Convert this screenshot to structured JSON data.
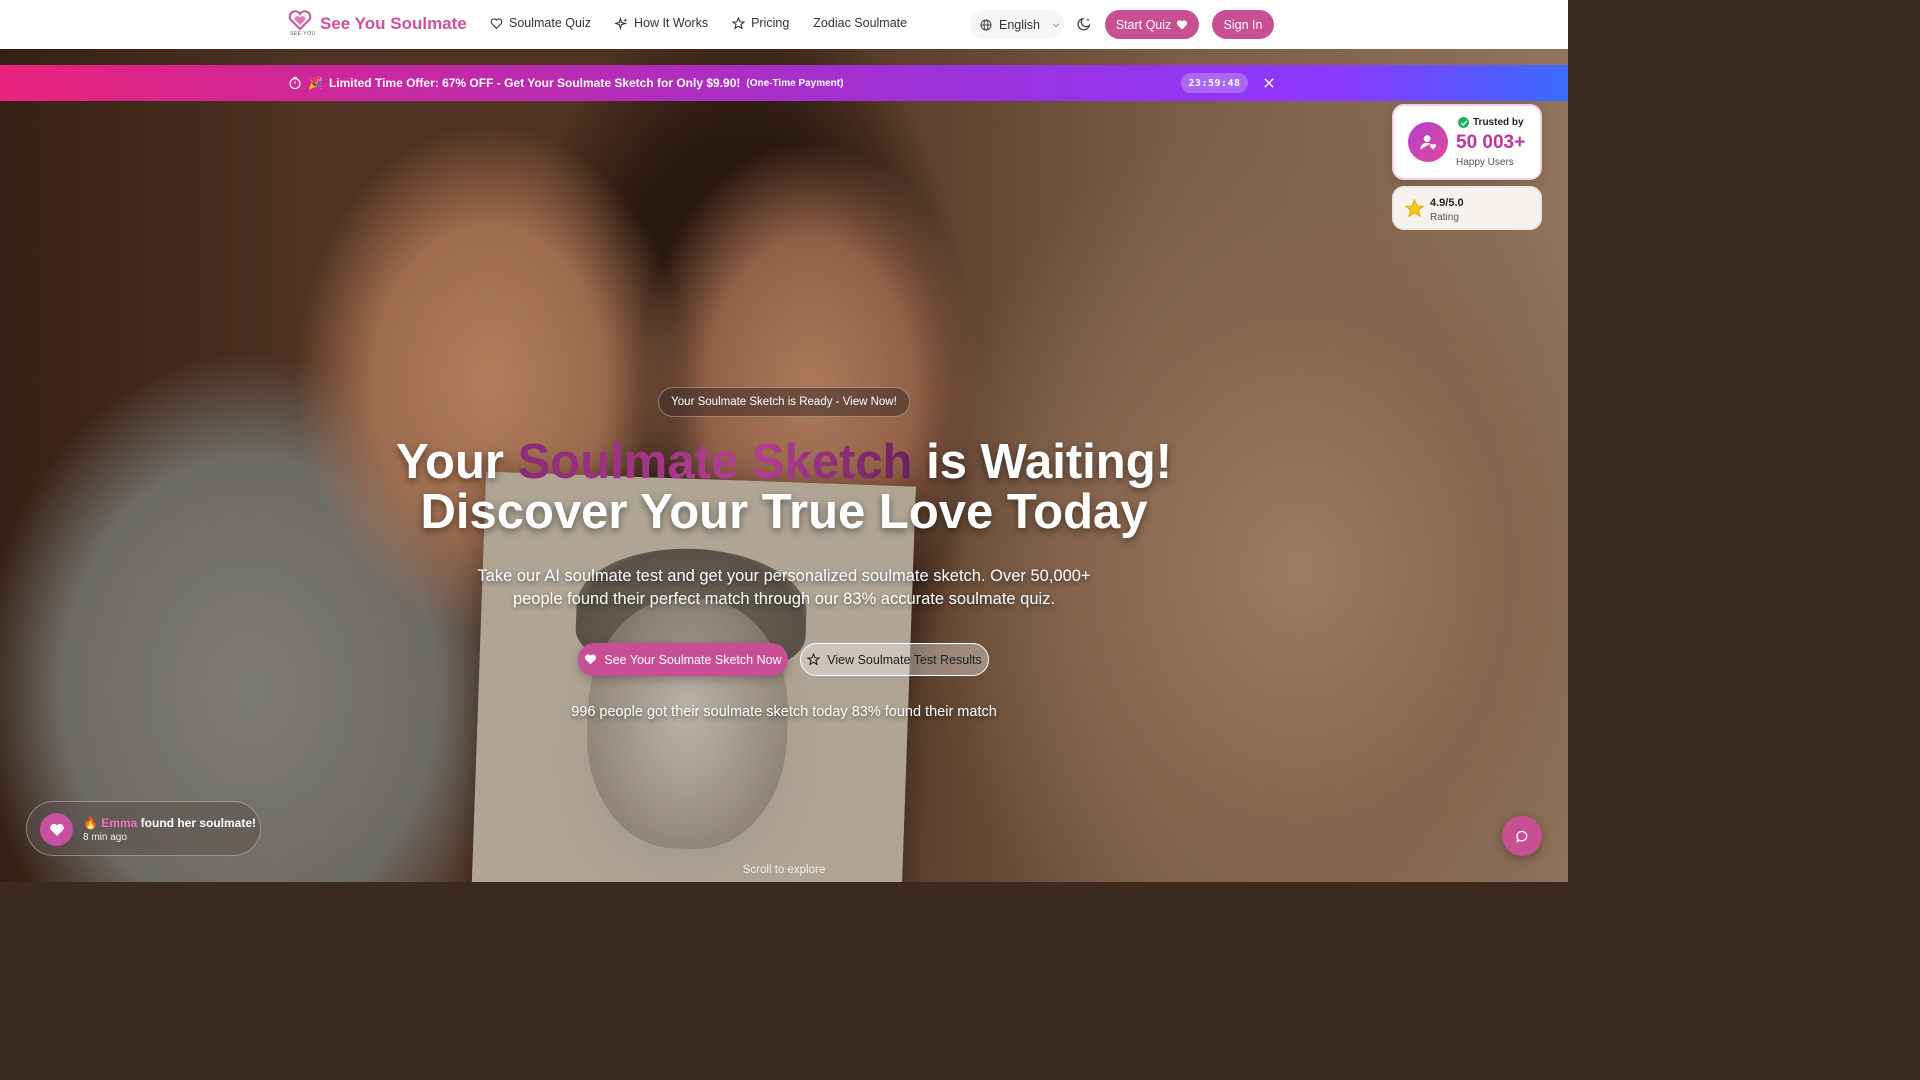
{
  "header": {
    "logo_text": "See You Soulmate",
    "logo_subtext": "SEE YOU",
    "nav": [
      {
        "label": "Soulmate Quiz",
        "icon": "heart-icon"
      },
      {
        "label": "How It Works",
        "icon": "sparkles-icon"
      },
      {
        "label": "Pricing",
        "icon": "star-icon"
      },
      {
        "label": "Zodiac Soulmate",
        "icon": ""
      }
    ],
    "language": "English",
    "start_quiz": "Start Quiz",
    "sign_in": "Sign In"
  },
  "promo": {
    "emoji": "🎉",
    "text": "Limited Time Offer: 67% OFF - Get Your Soulmate Sketch for Only $9.90!",
    "note": "(One-Time Payment)",
    "timer": "23:59:48"
  },
  "trust": {
    "label": "Trusted by",
    "count": "50 003+",
    "sub": "Happy Users",
    "rating": "4.9/5.0",
    "rating_label": "Rating"
  },
  "hero": {
    "pill": "Your Soulmate Sketch is Ready - View Now!",
    "headline_prefix": "Your ",
    "headline_accent": "Soulmate Sketch",
    "headline_suffix": " is Waiting!",
    "headline_line2": "Discover Your True Love Today",
    "subtext": "Take our AI soulmate test and get your personalized soulmate sketch. Over 50,000+ people found their perfect match through our 83% accurate soulmate quiz.",
    "cta_primary": "See Your Soulmate Sketch Now",
    "cta_secondary": "View Soulmate Test Results",
    "stats": "996 people got their soulmate sketch today 83% found their match",
    "scroll_hint": "Scroll to explore"
  },
  "toast": {
    "emoji": "🔥",
    "name": "Emma",
    "message": " found her soulmate!",
    "time": "8 min ago"
  },
  "colors": {
    "brand_pink": "#c94f93",
    "promo_start": "#e8237a",
    "promo_end": "#3a6cff"
  }
}
